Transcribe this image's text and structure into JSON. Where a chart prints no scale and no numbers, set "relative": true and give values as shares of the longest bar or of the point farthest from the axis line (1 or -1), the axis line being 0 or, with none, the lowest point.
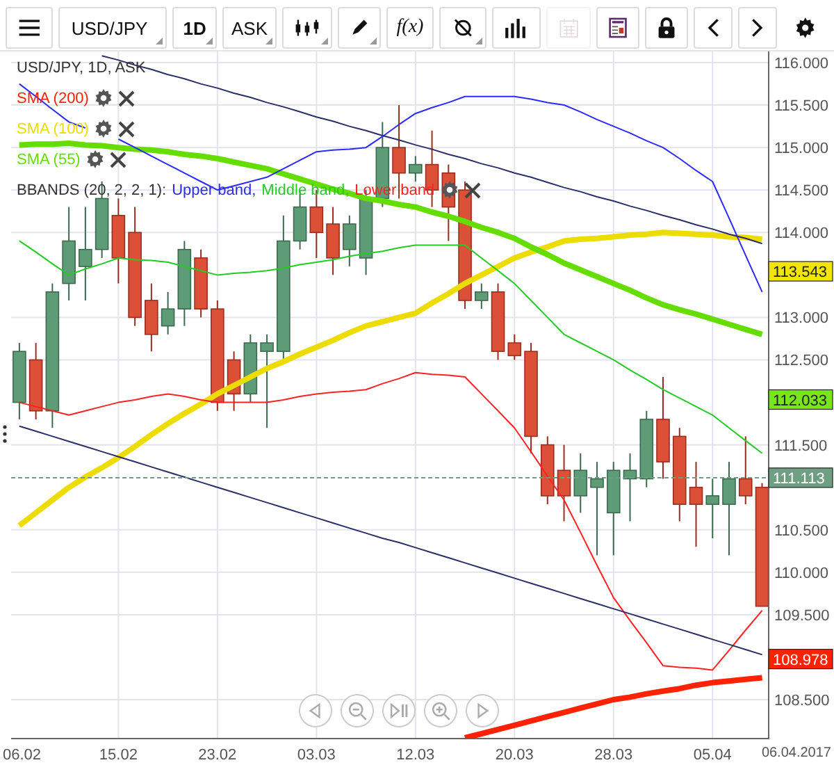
{
  "toolbar": [
    {
      "kind": "menu",
      "disabled": false,
      "dropdown": false
    },
    {
      "kind": "dropdown",
      "label": "USD/JPY",
      "bold": false,
      "disabled": false,
      "dropdown": true
    },
    {
      "kind": "dropdown",
      "label": "1D",
      "bold": true,
      "disabled": false,
      "dropdown": true
    },
    {
      "kind": "dropdown",
      "label": "ASK",
      "bold": false,
      "disabled": false,
      "dropdown": true
    },
    {
      "kind": "candles",
      "disabled": false,
      "dropdown": true
    },
    {
      "kind": "pencil",
      "disabled": false,
      "dropdown": true
    },
    {
      "kind": "formula",
      "label": "f(x)",
      "bold": false,
      "disabled": false,
      "dropdown": false
    },
    {
      "kind": "crossed",
      "disabled": false,
      "dropdown": true
    },
    {
      "kind": "bars",
      "disabled": false,
      "dropdown": false
    },
    {
      "kind": "calendar",
      "disabled": true,
      "dropdown": false
    },
    {
      "kind": "report",
      "disabled": false,
      "dropdown": false
    },
    {
      "kind": "lock",
      "disabled": false,
      "dropdown": false
    },
    {
      "kind": "prev",
      "disabled": false,
      "dropdown": false
    },
    {
      "kind": "next",
      "disabled": false,
      "dropdown": false
    },
    {
      "kind": "settings",
      "disabled": false,
      "dropdown": false
    }
  ],
  "legend": {
    "title": "USD/JPY, 1D, ASK",
    "bbands_label": "BBANDS (20, 2, 2, 1):"
  },
  "chart": {
    "date_label": "06.04.2017",
    "price_tags": [
      {
        "color": "#f2e600"
      },
      {
        "color": "#77e61a"
      },
      {
        "color": "#ff2200"
      }
    ],
    "chart_data": {
      "type": "candlestick",
      "ylim": [
        108.042,
        116.131
      ],
      "grid": true,
      "categories": [
        "06.02",
        null,
        null,
        null,
        null,
        null,
        "15.02",
        null,
        null,
        null,
        null,
        null,
        "23.02",
        null,
        null,
        null,
        null,
        null,
        "03.03",
        null,
        null,
        null,
        null,
        null,
        "12.03",
        null,
        null,
        null,
        null,
        null,
        "20.03",
        null,
        null,
        null,
        null,
        null,
        "28.03",
        null,
        null,
        null,
        null,
        null,
        "05.04",
        null,
        null,
        null
      ],
      "yticks": [
        {
          "value": 116,
          "label": "116.000"
        },
        {
          "value": 115.5,
          "label": "115.500"
        },
        {
          "value": 115,
          "label": "115.000"
        },
        {
          "value": 114.5,
          "label": "114.500"
        },
        {
          "value": 114,
          "label": "114.000"
        },
        {
          "value": 113,
          "label": "113.000"
        },
        {
          "value": 112.5,
          "label": "112.500"
        },
        {
          "value": 111.5,
          "label": "111.500"
        },
        {
          "value": 110.5,
          "label": "110.500"
        },
        {
          "value": 110,
          "label": "110.000"
        },
        {
          "value": 109.5,
          "label": "109.500"
        },
        {
          "value": 108.5,
          "label": "108.500"
        },
        {
          "value": 113.543,
          "label": "113.543"
        },
        {
          "value": 112.033,
          "label": "112.033"
        },
        {
          "value": 108.978,
          "label": "108.978"
        }
      ],
      "ohlc": [
        [
          112.0,
          112.7,
          111.8,
          112.6
        ],
        [
          112.5,
          112.7,
          111.8,
          111.9
        ],
        [
          111.9,
          113.4,
          111.7,
          113.3
        ],
        [
          113.4,
          114.3,
          113.2,
          113.9
        ],
        [
          113.6,
          114.3,
          113.2,
          113.8
        ],
        [
          113.8,
          114.6,
          113.7,
          114.4
        ],
        [
          114.2,
          114.4,
          113.4,
          113.7
        ],
        [
          114.0,
          114.3,
          112.9,
          113.0
        ],
        [
          113.2,
          113.4,
          112.6,
          112.8
        ],
        [
          112.9,
          113.3,
          112.8,
          113.1
        ],
        [
          113.1,
          113.9,
          112.9,
          113.8
        ],
        [
          113.7,
          113.8,
          113.0,
          113.1
        ],
        [
          113.1,
          113.2,
          111.9,
          112.0
        ],
        [
          112.5,
          112.6,
          111.9,
          112.1
        ],
        [
          112.1,
          112.8,
          112.0,
          112.7
        ],
        [
          112.6,
          112.8,
          111.7,
          112.7
        ],
        [
          112.6,
          114.2,
          112.5,
          113.9
        ],
        [
          113.9,
          114.5,
          113.8,
          114.3
        ],
        [
          114.3,
          114.5,
          113.7,
          114.0
        ],
        [
          114.1,
          114.3,
          113.5,
          113.7
        ],
        [
          113.8,
          114.2,
          113.6,
          114.1
        ],
        [
          113.7,
          114.5,
          113.5,
          114.4
        ],
        [
          114.4,
          115.3,
          114.3,
          115.0
        ],
        [
          115.0,
          115.5,
          114.4,
          114.7
        ],
        [
          114.7,
          114.9,
          114.6,
          114.8
        ],
        [
          114.8,
          115.2,
          114.3,
          114.5
        ],
        [
          114.7,
          114.8,
          113.9,
          114.3
        ],
        [
          114.5,
          114.6,
          113.1,
          113.2
        ],
        [
          113.2,
          113.4,
          113.1,
          113.3
        ],
        [
          113.3,
          113.4,
          112.5,
          112.6
        ],
        [
          112.7,
          112.8,
          112.5,
          112.55
        ],
        [
          112.6,
          112.7,
          111.4,
          111.6
        ],
        [
          111.5,
          111.6,
          110.8,
          110.9
        ],
        [
          111.2,
          111.5,
          110.6,
          110.9
        ],
        [
          110.9,
          111.4,
          110.7,
          111.2
        ],
        [
          111.0,
          111.3,
          110.2,
          111.1
        ],
        [
          110.7,
          111.3,
          110.2,
          111.2
        ],
        [
          111.1,
          111.4,
          110.6,
          111.2
        ],
        [
          111.1,
          111.9,
          111.0,
          111.8
        ],
        [
          111.8,
          112.3,
          111.1,
          111.3
        ],
        [
          111.6,
          111.7,
          110.6,
          110.8
        ],
        [
          111.0,
          111.3,
          110.3,
          110.8
        ],
        [
          110.8,
          111.1,
          110.4,
          110.9
        ],
        [
          110.8,
          111.3,
          110.2,
          111.1
        ],
        [
          111.1,
          111.6,
          110.8,
          110.9
        ],
        [
          111.0,
          111.05,
          109.6,
          109.6
        ]
      ],
      "ref_lines": [
        {
          "axis": "y",
          "value": 111.113,
          "label": "111.113",
          "color": "#6f9f82"
        }
      ]
    }
  },
  "indicators": {
    "chart_data": {
      "type": "line",
      "relative": true,
      "grid": true,
      "ylim": [
        108.042,
        116.131
      ],
      "series": [
        {
          "name": "SMA (200)",
          "color": "#ff2200",
          "values": [
            null,
            null,
            null,
            null,
            null,
            null,
            null,
            null,
            null,
            null,
            null,
            null,
            null,
            null,
            null,
            null,
            null,
            null,
            null,
            null,
            null,
            null,
            null,
            null,
            null,
            null,
            null,
            108.05,
            108.1,
            108.15,
            108.2,
            108.25,
            108.3,
            108.35,
            108.4,
            108.45,
            108.5,
            108.53,
            108.57,
            108.6,
            108.63,
            108.67,
            108.7,
            108.72,
            108.74,
            108.76
          ]
        },
        {
          "name": "SMA (100)",
          "color": "#ecdc00",
          "values": [
            110.55,
            110.7,
            110.85,
            111.0,
            111.12,
            111.23,
            111.35,
            111.48,
            111.62,
            111.75,
            111.87,
            111.98,
            112.1,
            112.2,
            112.3,
            112.4,
            112.48,
            112.57,
            112.65,
            112.73,
            112.82,
            112.9,
            112.95,
            113.0,
            113.05,
            113.17,
            113.28,
            113.4,
            113.5,
            113.6,
            113.7,
            113.77,
            113.83,
            113.9,
            113.92,
            113.93,
            113.95,
            113.97,
            113.98,
            114.0,
            113.99,
            113.98,
            113.97,
            113.95,
            113.94,
            113.92
          ]
        },
        {
          "name": "SMA (55)",
          "color": "#66dd00",
          "values": [
            115.03,
            115.04,
            115.04,
            115.05,
            115.03,
            115.02,
            115.0,
            114.98,
            114.97,
            114.95,
            114.92,
            114.9,
            114.87,
            114.83,
            114.79,
            114.75,
            114.69,
            114.63,
            114.57,
            114.51,
            114.46,
            114.4,
            114.37,
            114.33,
            114.3,
            114.24,
            114.19,
            114.13,
            114.06,
            114.0,
            113.93,
            113.83,
            113.74,
            113.64,
            113.56,
            113.48,
            113.4,
            113.32,
            113.23,
            113.15,
            113.09,
            113.04,
            112.98,
            112.92,
            112.86,
            112.8
          ]
        },
        {
          "name": "Upper band,",
          "color": "#2b2bff",
          "values": [
            115.75,
            115.6,
            115.45,
            115.3,
            115.23,
            null,
            115.1,
            115.0,
            114.9,
            114.8,
            114.7,
            114.6,
            114.5,
            114.55,
            114.6,
            114.65,
            114.75,
            114.85,
            114.95,
            114.97,
            114.98,
            115.0,
            115.13,
            115.27,
            115.4,
            115.47,
            115.53,
            115.6,
            115.6,
            115.6,
            115.6,
            115.57,
            115.53,
            115.5,
            115.42,
            115.33,
            115.25,
            115.17,
            115.08,
            115.0,
            114.87,
            114.73,
            114.6,
            114.17,
            113.73,
            113.3
          ]
        },
        {
          "name": "Middle band,",
          "color": "#22cc22",
          "values": [
            113.9,
            113.77,
            113.63,
            113.5,
            113.57,
            113.63,
            113.7,
            113.68,
            113.67,
            113.65,
            113.6,
            113.55,
            113.5,
            113.52,
            113.53,
            113.55,
            113.58,
            113.62,
            113.65,
            113.68,
            113.72,
            113.75,
            113.78,
            113.82,
            113.85,
            113.85,
            113.85,
            113.85,
            113.7,
            113.55,
            113.4,
            113.2,
            113.0,
            112.8,
            112.7,
            112.6,
            112.5,
            112.38,
            112.27,
            112.15,
            112.05,
            111.95,
            111.85,
            111.7,
            111.55,
            111.4
          ]
        },
        {
          "name": "Lower band",
          "color": "#ff2222",
          "values": [
            112.0,
            111.95,
            111.9,
            111.85,
            111.9,
            111.95,
            112.0,
            112.03,
            112.07,
            112.1,
            112.07,
            112.03,
            112.0,
            112.0,
            112.0,
            112.0,
            112.03,
            112.07,
            112.1,
            112.12,
            112.13,
            112.15,
            112.22,
            112.28,
            112.35,
            112.33,
            112.32,
            112.3,
            112.1,
            111.9,
            111.7,
            111.42,
            111.13,
            110.85,
            110.47,
            110.08,
            109.7,
            109.43,
            109.17,
            108.9,
            108.88,
            108.87,
            108.85,
            109.08,
            109.32,
            109.55
          ]
        },
        {
          "color": "#2a2f6a",
          "values": [
            null,
            null,
            null,
            null,
            null,
            116.08,
            116.03,
            115.97,
            115.92,
            115.86,
            115.81,
            115.75,
            115.7,
            115.64,
            115.59,
            115.53,
            115.48,
            115.42,
            115.36,
            115.31,
            115.25,
            115.2,
            115.14,
            115.09,
            115.03,
            114.98,
            114.92,
            114.87,
            114.81,
            114.76,
            114.7,
            114.65,
            114.59,
            114.53,
            114.48,
            114.42,
            114.37,
            114.31,
            114.26,
            114.2,
            114.15,
            114.09,
            114.04,
            113.98,
            113.93,
            113.87
          ]
        },
        {
          "color": "#2a2f6a",
          "values": [
            111.72,
            111.66,
            111.6,
            111.54,
            111.48,
            111.42,
            111.36,
            111.3,
            111.24,
            111.18,
            111.12,
            111.06,
            111.0,
            110.94,
            110.88,
            110.82,
            110.76,
            110.7,
            110.64,
            110.58,
            110.52,
            110.46,
            110.4,
            110.35,
            110.29,
            110.23,
            110.17,
            110.11,
            110.05,
            109.99,
            109.93,
            109.87,
            109.81,
            109.75,
            109.69,
            109.63,
            109.57,
            109.51,
            109.45,
            109.39,
            109.33,
            109.27,
            109.21,
            109.15,
            109.09,
            109.03
          ]
        }
      ]
    }
  },
  "navigation": [
    {
      "kind": "back"
    },
    {
      "kind": "zoom-out"
    },
    {
      "kind": "end"
    },
    {
      "kind": "zoom-in"
    },
    {
      "kind": "forward"
    }
  ]
}
